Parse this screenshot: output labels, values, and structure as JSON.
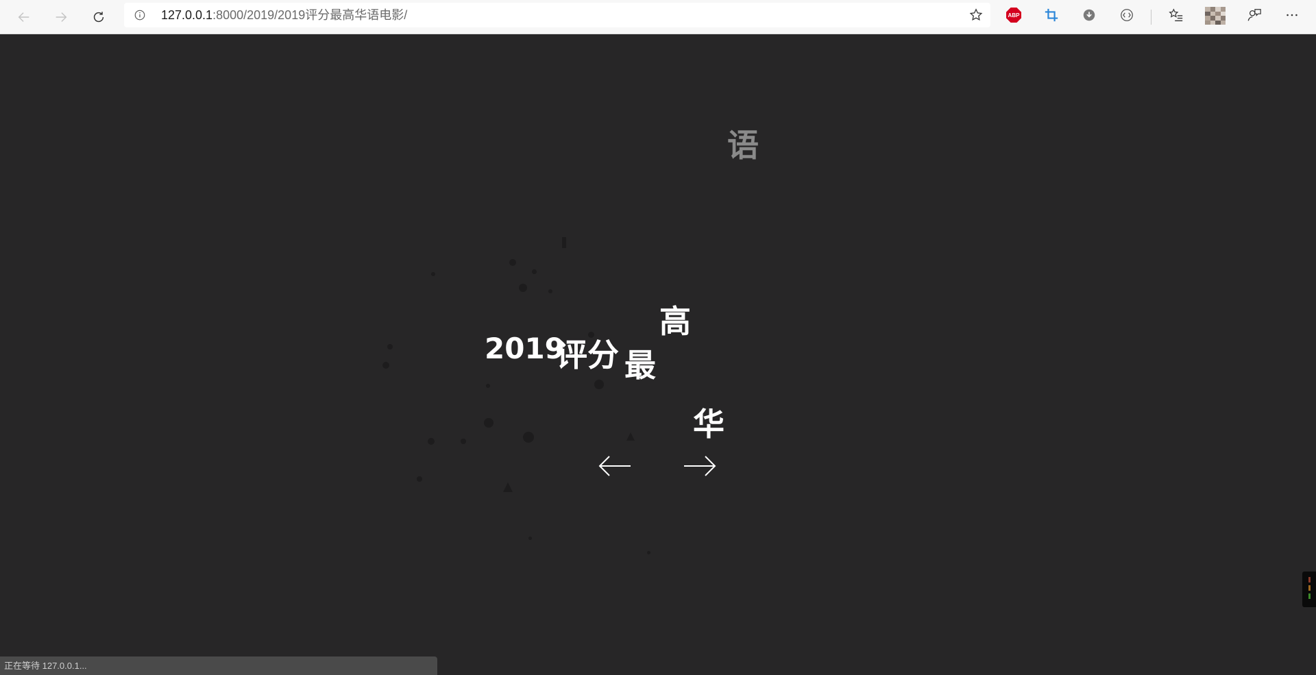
{
  "browser": {
    "url_host": "127.0.0.1",
    "url_path": ":8000/2019/2019评分最高华语电影/",
    "extensions": [
      "adblock-plus",
      "crop-tool",
      "download",
      "sync"
    ],
    "adblock_label": "ABP"
  },
  "page": {
    "title_pieces": {
      "year": "2019",
      "rating": "评分",
      "most": "最",
      "high": "高",
      "chinese": "华",
      "language": "语"
    },
    "prev_icon": "arrow-left-icon",
    "next_icon": "arrow-right-icon"
  },
  "status": {
    "text": "正在等待 127.0.0.1..."
  },
  "colors": {
    "background": "#272627",
    "text": "#ffffff",
    "faded_text": "#8a8a8a",
    "toolbar": "#f7f7f7"
  }
}
